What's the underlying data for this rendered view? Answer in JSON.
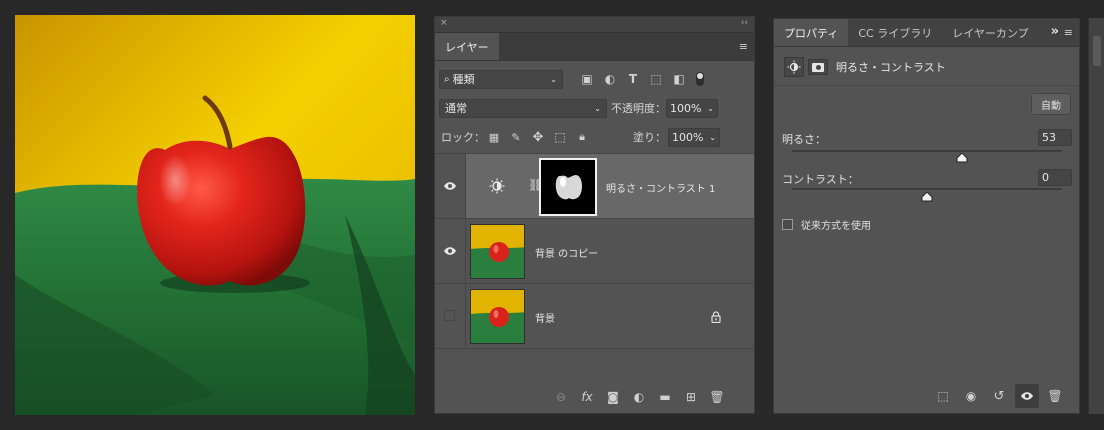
{
  "layers_panel": {
    "collapse_glyph": "×",
    "expand_glyph": "‹‹",
    "tab_label": "レイヤー",
    "menu_glyph": "≡",
    "filter_kind": "種類",
    "blend_mode": "通常",
    "opacity_label": "不透明度：",
    "opacity_value": "100%",
    "lock_label": "ロック：",
    "fill_label": "塗り：",
    "fill_value": "100%",
    "layers": [
      {
        "name": "明るさ・コントラスト 1",
        "visible": true,
        "selected": true,
        "type": "adjustment"
      },
      {
        "name": "背景 のコピー",
        "visible": true,
        "selected": false,
        "type": "pixel"
      },
      {
        "name": "背景",
        "visible": false,
        "selected": false,
        "type": "pixel",
        "locked": true
      }
    ],
    "footer_icons": [
      "link-icon",
      "fx-icon",
      "mask-icon",
      "adjustment-icon",
      "folder-icon",
      "new-layer-icon",
      "trash-icon"
    ],
    "fx_label": "fx"
  },
  "properties_panel": {
    "tabs": [
      "プロパティ",
      "CC ライブラリ",
      "レイヤーカンプ"
    ],
    "overflow_glyph": "»",
    "menu_glyph": "≡",
    "header_title": "明るさ・コントラスト",
    "auto_button": "自動",
    "brightness_label": "明るさ：",
    "brightness_value": "53",
    "brightness_level": 0.63,
    "contrast_label": "コントラスト：",
    "contrast_value": "0",
    "contrast_level": 0.5,
    "legacy_label": "従来方式を使用",
    "legacy_checked": false,
    "footer_icons": [
      "clip-to-layer-icon",
      "view-previous-icon",
      "reset-icon",
      "visibility-icon",
      "trash-icon"
    ]
  },
  "colors": {
    "panel_bg": "#535353",
    "selected_layer": "#686868",
    "yellow": "#e8b800",
    "green": "#2e7a3e",
    "apple_red": "#d4201c"
  }
}
